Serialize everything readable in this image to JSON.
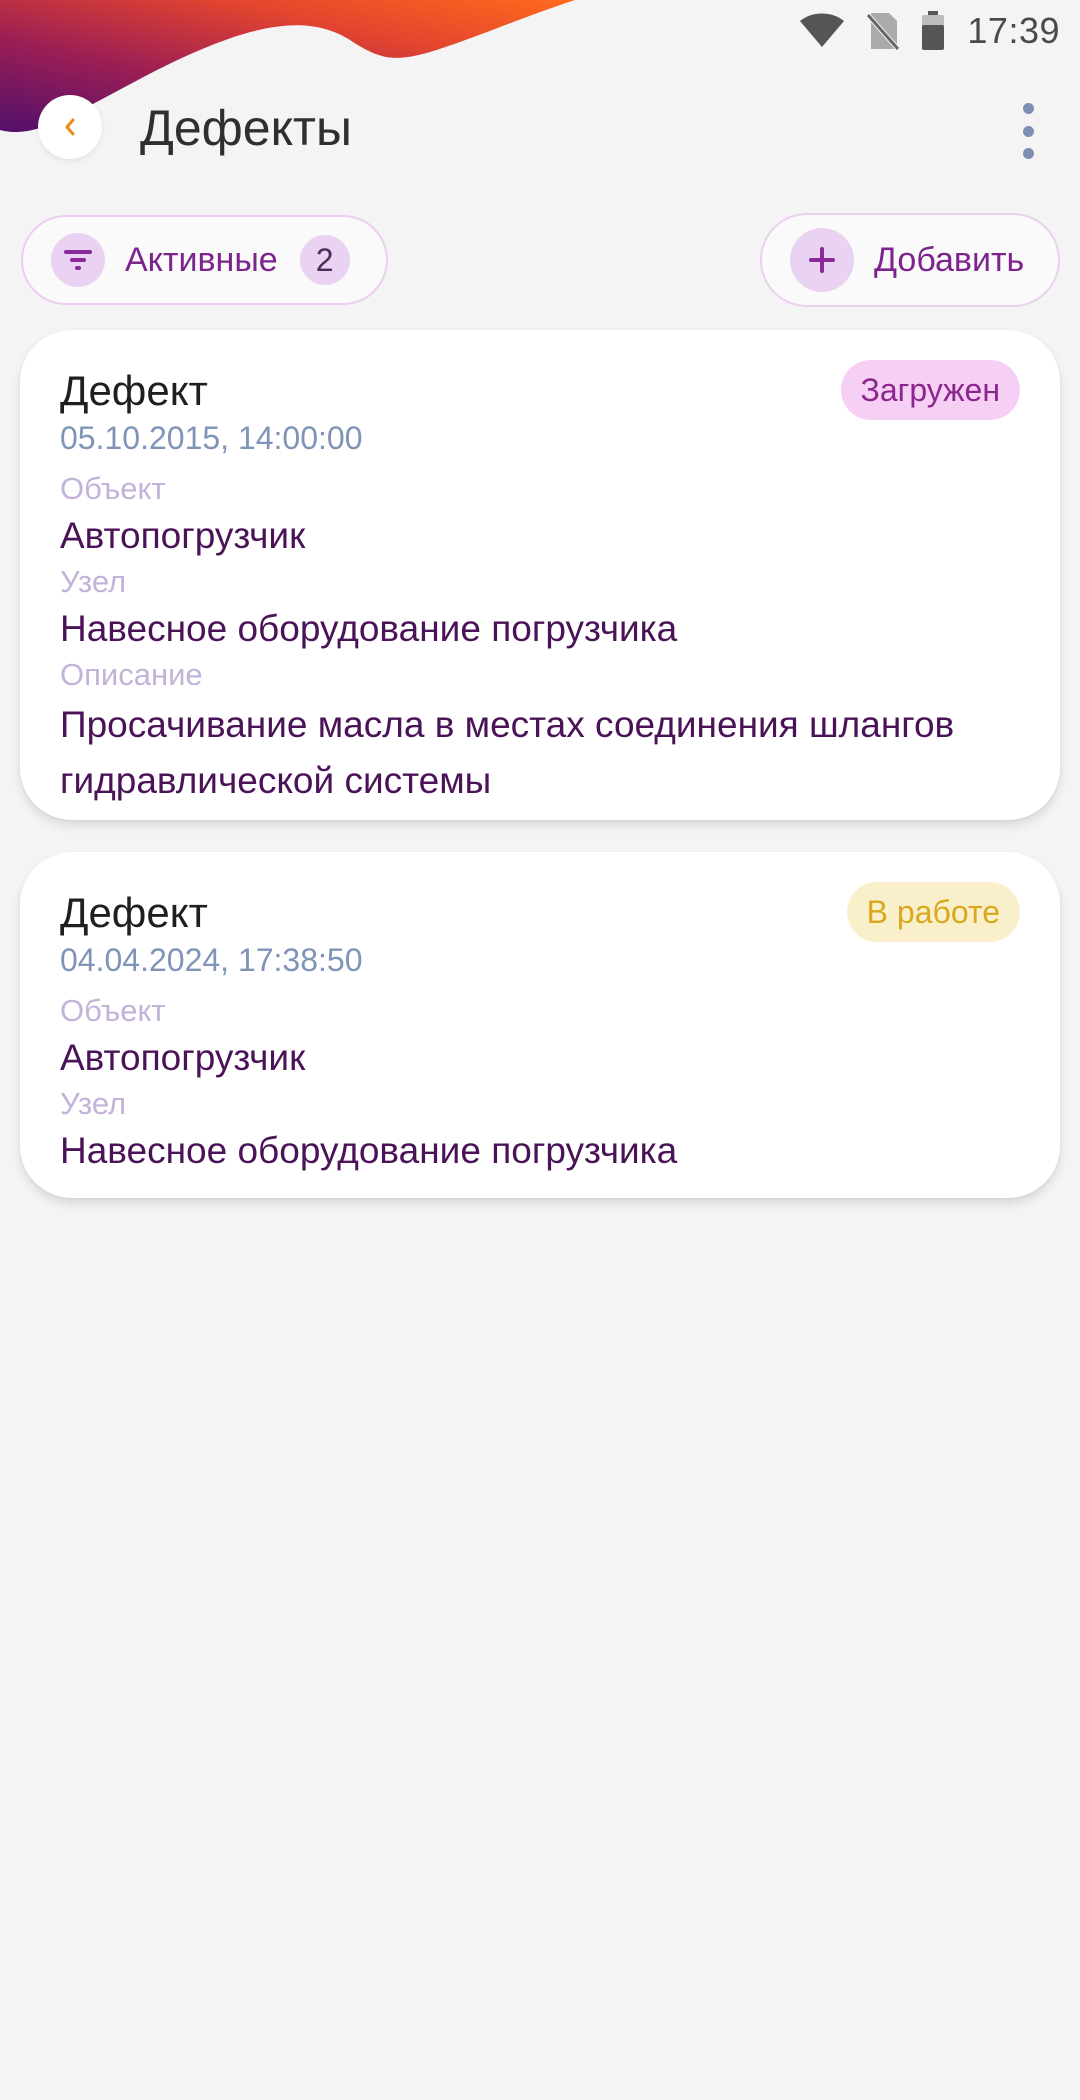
{
  "statusbar": {
    "time": "17:39",
    "icons": [
      "wifi-icon",
      "no-sim-icon",
      "battery-icon"
    ]
  },
  "appbar": {
    "title": "Дефекты",
    "back_icon": "chevron-left-icon",
    "menu_icon": "more-vertical-icon"
  },
  "filter": {
    "label": "Активные",
    "count": "2",
    "icon": "filter-icon"
  },
  "add_button": {
    "label": "Добавить",
    "icon": "plus-icon"
  },
  "defects": [
    {
      "title": "Дефект",
      "date": "05.10.2015, 14:00:00",
      "status": "Загружен",
      "object_label": "Объект",
      "object_value": "Автопогрузчик",
      "node_label": "Узел",
      "node_value": "Навесное оборудование погрузчика",
      "description_label": "Описание",
      "description_value": "Просачивание масла в местах соединения шлангов гидравлической системы"
    },
    {
      "title": "Дефект",
      "date": "04.04.2024, 17:38:50",
      "status": "В работе",
      "object_label": "Объект",
      "object_value": "Автопогрузчик",
      "node_label": "Узел",
      "node_value": "Навесное оборудование погрузчика"
    }
  ],
  "colors": {
    "accent": "#7d238e",
    "accent_light": "#ead3f2",
    "status_loaded_bg": "#f6cff5",
    "status_working_bg": "#faefcb",
    "status_working_text": "#d9a91d",
    "back_chevron": "#f08a18"
  }
}
